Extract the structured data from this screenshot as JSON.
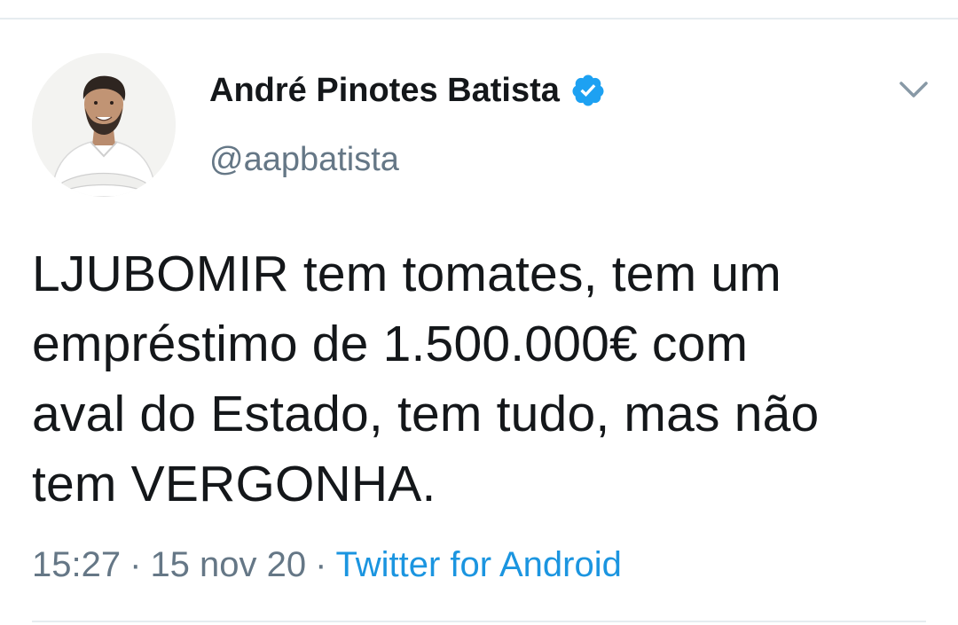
{
  "tweet": {
    "author": {
      "display_name": "André Pinotes Batista",
      "handle": "@aapbatista",
      "verified": true
    },
    "text_lines": [
      "LJUBOMIR tem tomates, tem um",
      "empréstimo de 1.500.000€ com",
      "aval do Estado, tem tudo, mas não",
      "tem VERGONHA."
    ],
    "time": "15:27",
    "date": "15 nov 20",
    "separator": "·",
    "source": "Twitter for Android"
  },
  "icons": {
    "verified": "verified-badge-icon",
    "menu": "chevron-down-icon"
  },
  "colors": {
    "text": "#14171a",
    "secondary": "#657786",
    "link": "#1b95e0",
    "verified": "#1da1f2",
    "divider": "#e6ecf0"
  }
}
